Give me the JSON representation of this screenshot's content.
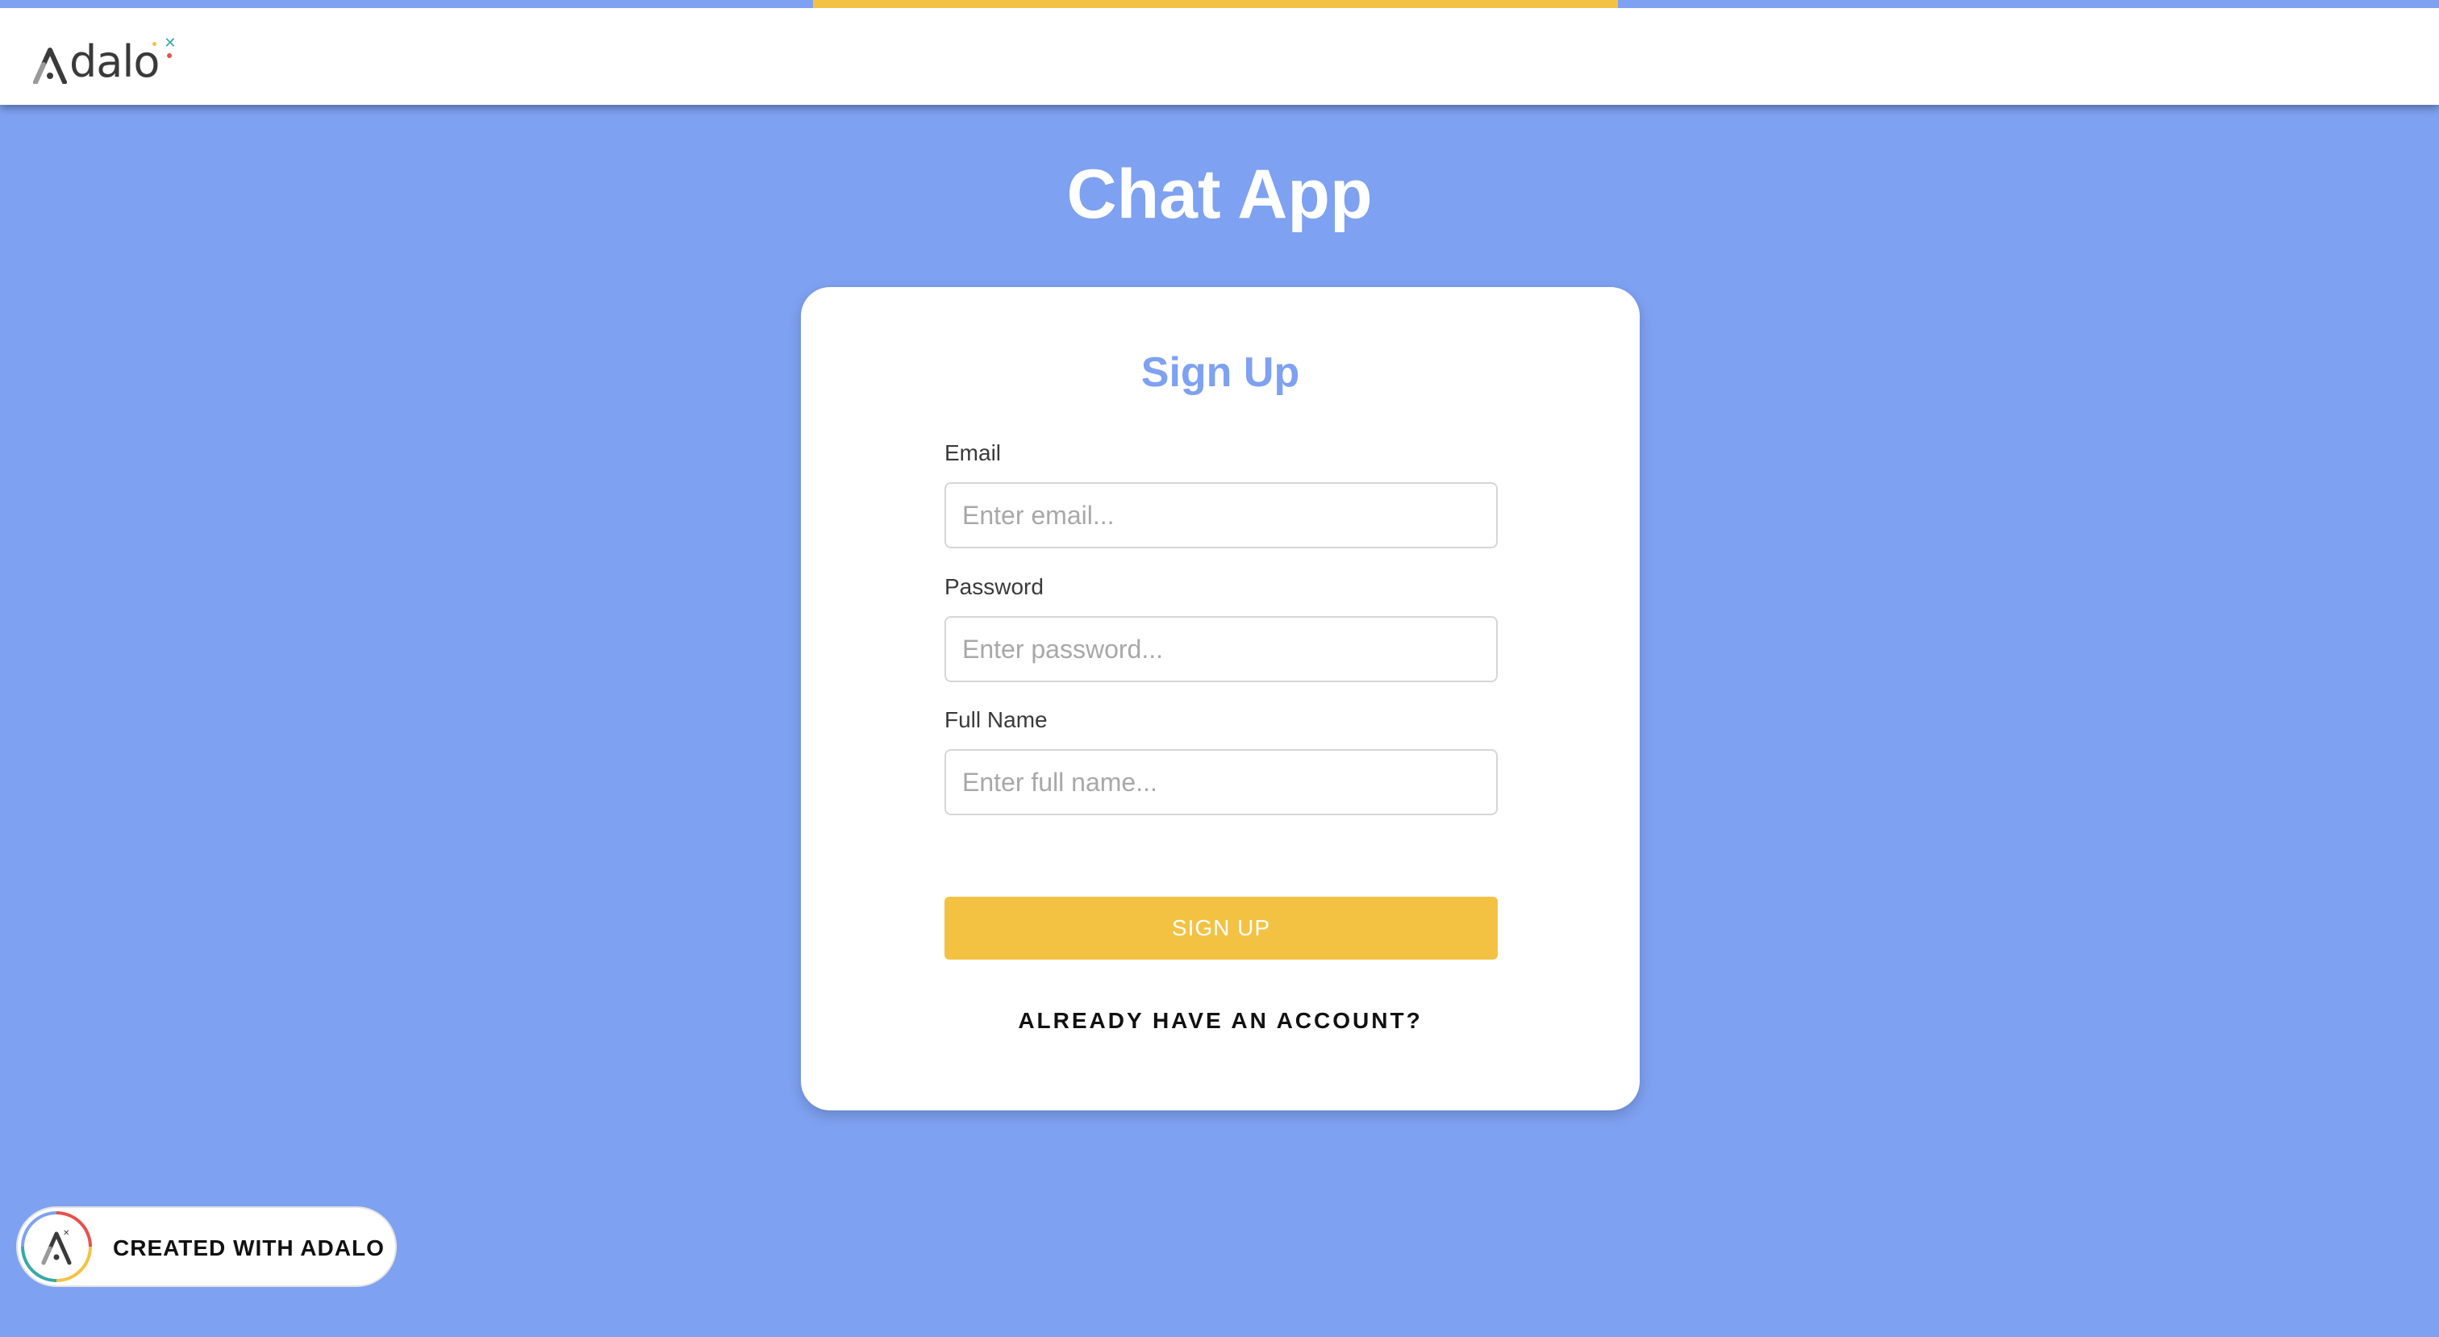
{
  "brand": {
    "logo_text": "Adalo",
    "primary_color": "#7EA1F1",
    "accent_color": "#F4C243"
  },
  "loading_bar": {
    "progress_fraction": 0.33
  },
  "page": {
    "title": "Chat App"
  },
  "signup_form": {
    "title": "Sign Up",
    "fields": [
      {
        "label": "Email",
        "placeholder": "Enter email...",
        "value": ""
      },
      {
        "label": "Password",
        "placeholder": "Enter password...",
        "value": ""
      },
      {
        "label": "Full Name",
        "placeholder": "Enter full name...",
        "value": ""
      }
    ],
    "submit_label": "SIGN UP",
    "login_link_label": "ALREADY HAVE AN ACCOUNT?"
  },
  "badge": {
    "label": "CREATED WITH ADALO",
    "icon": "adalo-logo-icon"
  }
}
